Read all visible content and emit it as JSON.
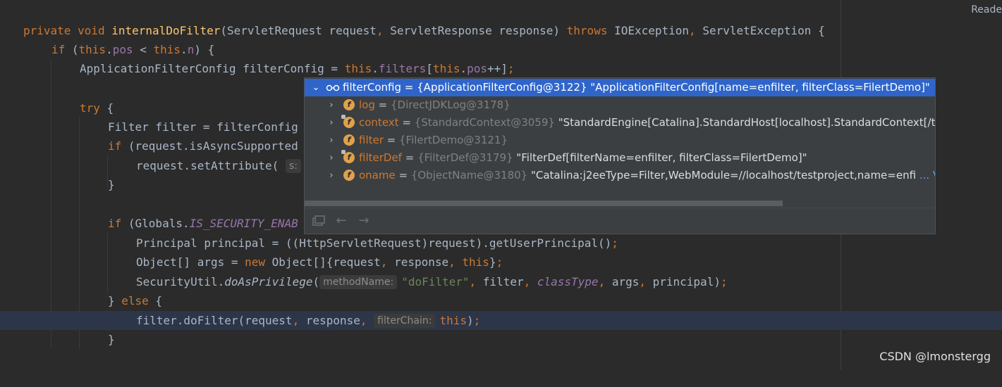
{
  "editor": {
    "header_right": "Reade",
    "line1": {
      "k_private": "private",
      "k_void": "void",
      "method": "internalDoFilter",
      "p1": "(ServletRequest request",
      "comma": ", ",
      "p2": "ServletResponse response) ",
      "k_throws": "throws",
      "exc": " IOException",
      "exc2": "ServletException {"
    },
    "line2": {
      "k_if": "if",
      "a": " (",
      "k_this": "this",
      "dot": ".",
      "pos": "pos",
      "lt": " < ",
      "k_this2": "this",
      "dot2": ".",
      "n": "n",
      "b": ") {"
    },
    "line3": {
      "a": "ApplicationFilterConfig filterConfig = ",
      "k_this": "this",
      "dot": ".",
      "filters": "filters",
      "br": "[",
      "k_this2": "this",
      "dot2": ".",
      "pos": "pos",
      "c": "++]",
      "semi": ";"
    },
    "line5": {
      "k_try": "try",
      "a": " {"
    },
    "line6": {
      "a": "Filter filter = filterConfig"
    },
    "line7": {
      "k_if": "if",
      "a": " (request.isAsyncSupported"
    },
    "line8": {
      "a": "request.setAttribute(",
      "hint": "s:"
    },
    "line9": {
      "a": "}"
    },
    "line11": {
      "k_if": "if",
      "a": " (Globals.",
      "field": "IS_SECURITY_ENAB"
    },
    "line12": {
      "a": "Principal principal = ((HttpServletRequest)request).getUserPrincipal()",
      "semi": ";"
    },
    "line13": {
      "a": "Object[] args = ",
      "k_new": "new",
      "b": " Object[]{request",
      "c1": ", ",
      "c": "response",
      "c2": ", ",
      "k_this": "this",
      "d": "}",
      "semi": ";"
    },
    "line14": {
      "a": "SecurityUtil.",
      "m": "doAsPrivilege",
      "b": "(",
      "hint": "methodName:",
      "str": "\"doFilter\"",
      "c1": ", ",
      "c": "filter",
      "c2": ", ",
      "f": "classType",
      "c3": ", ",
      "d": "args",
      "c4": ", ",
      "e": "principal)",
      "semi": ";"
    },
    "line15": {
      "a": "} ",
      "k_else": "else",
      "b": " {"
    },
    "line16": {
      "a": "filter.doFilter(request",
      "c1": ", ",
      "b": "response",
      "c2": ", ",
      "hint": "filterChain:",
      "k_this": "this",
      "c": ")",
      "semi": ";"
    },
    "line17": {
      "a": "}"
    }
  },
  "popup": {
    "root": {
      "name": "filterConfig",
      "eq": " = ",
      "ref": "{ApplicationFilterConfig@3122}",
      "value": " \"ApplicationFilterConfig[name=enfilter, filterClass=FilertDemo]\""
    },
    "children": [
      {
        "name": "log",
        "eq": " = ",
        "ref": "{DirectJDKLog@3178}",
        "value": "",
        "icon": "field-icon"
      },
      {
        "name": "context",
        "eq": " = ",
        "ref": "{StandardContext@3059}",
        "value": " \"StandardEngine[Catalina].StandardHost[localhost].StandardContext[/testpro",
        "icon": "field-icon"
      },
      {
        "name": "filter",
        "eq": " = ",
        "ref": "{FilertDemo@3121}",
        "value": "",
        "icon": "field-icon"
      },
      {
        "name": "filterDef",
        "eq": " = ",
        "ref": "{FilterDef@3179}",
        "value": " \"FilterDef[filterName=enfilter, filterClass=FilertDemo]\"",
        "icon": "field-icon"
      },
      {
        "name": "oname",
        "eq": " = ",
        "ref": "{ObjectName@3180}",
        "value": " \"Catalina:j2eeType=Filter,WebModule=//localhost/testproject,name=enfi",
        "link": "... View",
        "icon": "field-icon"
      }
    ],
    "footer": {
      "icons": [
        "pin-icon",
        "back-arrow-icon",
        "forward-arrow-icon"
      ]
    }
  },
  "watermark": "CSDN @lmonstergg"
}
